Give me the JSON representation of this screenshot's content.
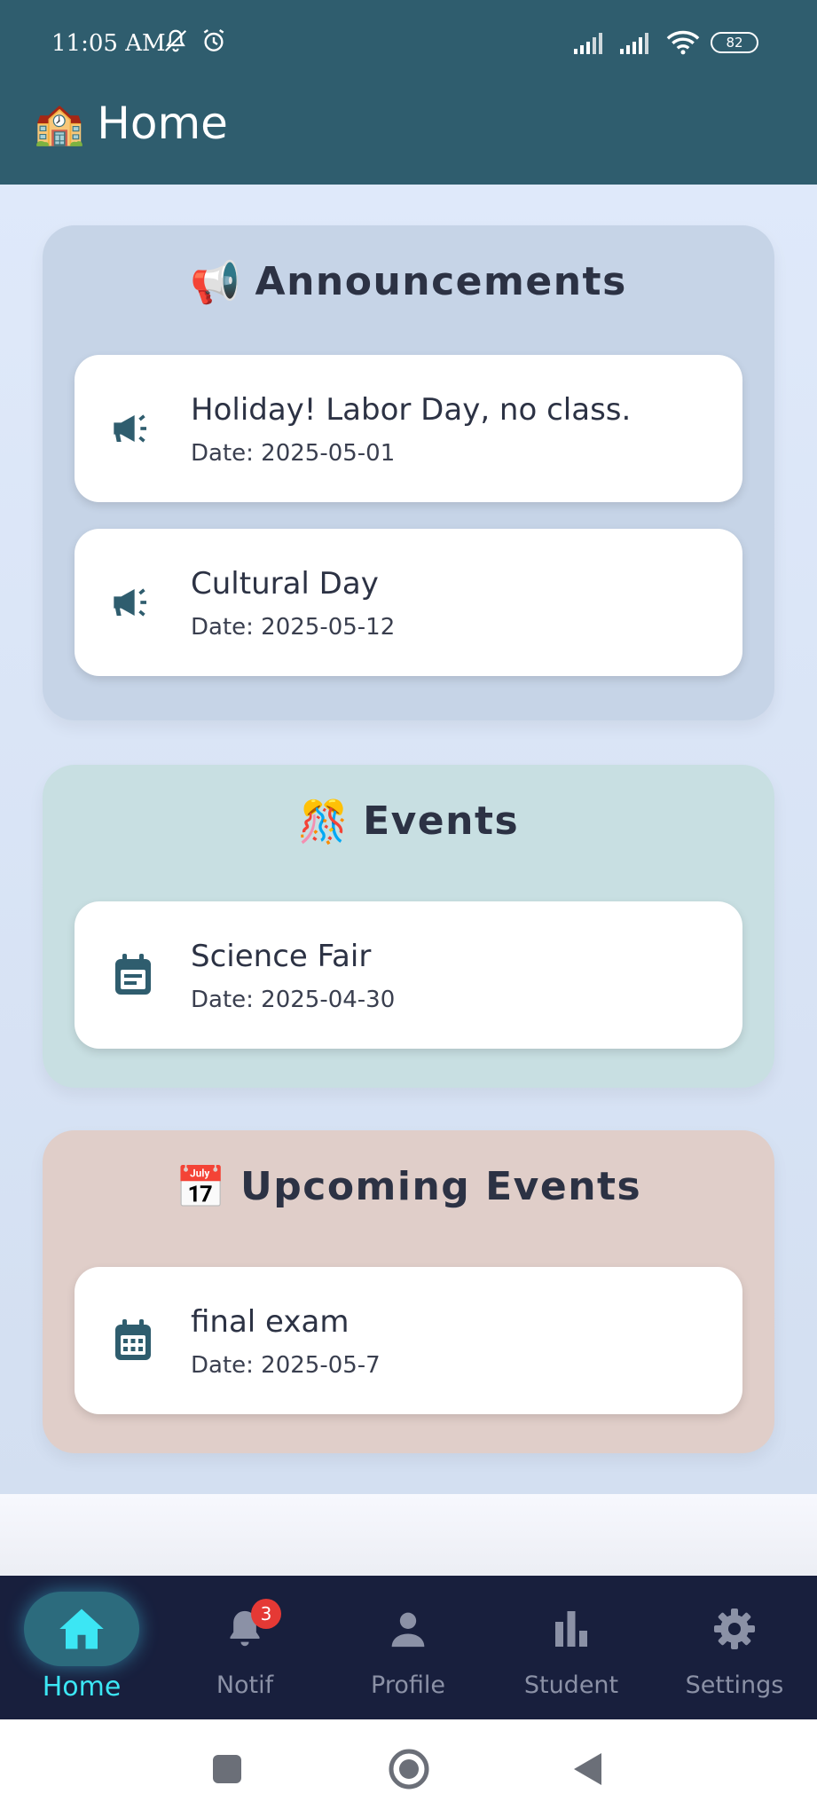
{
  "status_bar": {
    "time": "11:05 AM",
    "battery": "82",
    "icons": [
      "mute-icon",
      "alarm-icon",
      "signal-icon",
      "signal-icon",
      "wifi-icon",
      "battery-icon"
    ]
  },
  "app_bar": {
    "emoji": "🏫",
    "title": "Home"
  },
  "sections": {
    "announcements": {
      "emoji": "📢",
      "title": "Announcements",
      "items": [
        {
          "title": "Holiday! Labor Day, no class.",
          "date": "Date: 2025-05-01",
          "icon": "megaphone-icon"
        },
        {
          "title": "Cultural Day",
          "date": "Date: 2025-05-12",
          "icon": "megaphone-icon"
        }
      ]
    },
    "events": {
      "emoji": "🎊",
      "title": "Events",
      "items": [
        {
          "title": "Science Fair",
          "date": "Date: 2025-04-30",
          "icon": "event-note-icon"
        }
      ]
    },
    "upcoming": {
      "emoji": "📅",
      "title": "Upcoming Events",
      "items": [
        {
          "title": "final exam",
          "date": "Date: 2025-05-7",
          "icon": "calendar-month-icon"
        }
      ]
    }
  },
  "bottom_nav": {
    "items": [
      {
        "label": "Home",
        "icon": "home-icon",
        "active": true
      },
      {
        "label": "Notif",
        "icon": "bell-icon",
        "badge": "3"
      },
      {
        "label": "Profile",
        "icon": "person-icon"
      },
      {
        "label": "Student",
        "icon": "bar-chart-icon"
      },
      {
        "label": "Settings",
        "icon": "gear-icon"
      }
    ]
  },
  "colors": {
    "app_bar": "#2f5d6e",
    "nav_bg": "#181f3d",
    "active": "#3ce6f4",
    "icon": "#2f5d6e",
    "badge": "#e53935"
  }
}
